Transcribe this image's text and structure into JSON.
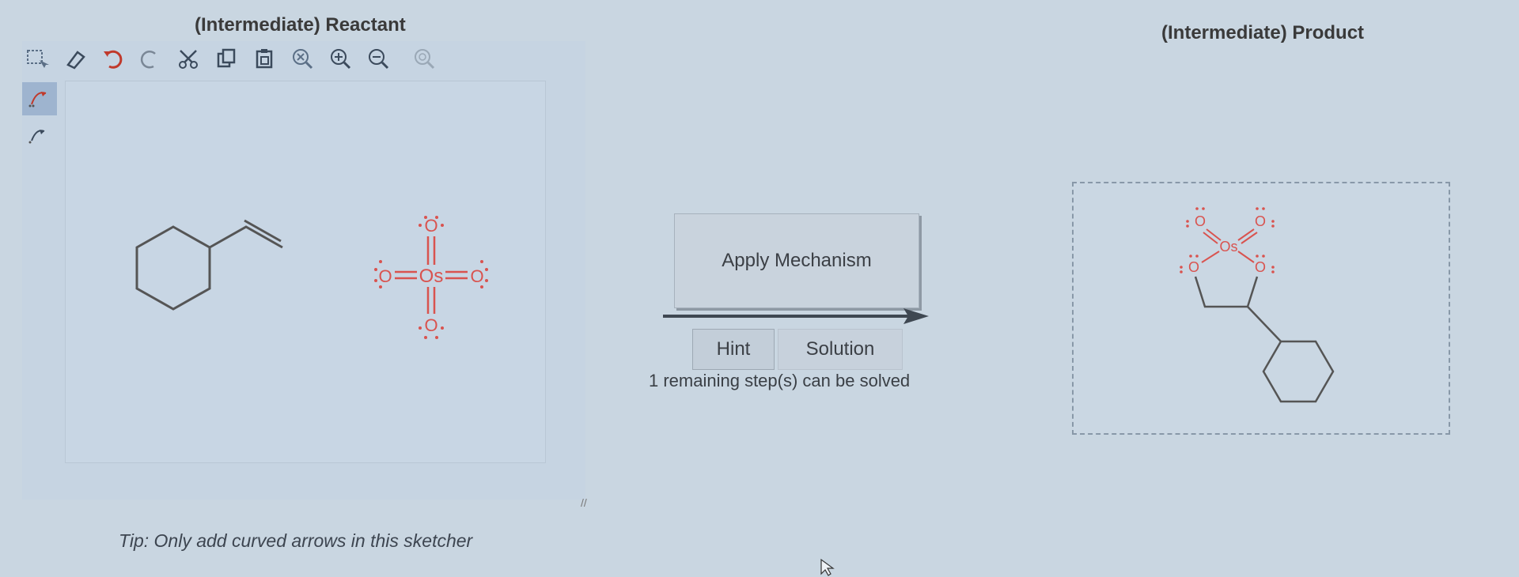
{
  "reactant_panel": {
    "title": "(Intermediate) Reactant",
    "tip": "Tip: Only add curved arrows in this sketcher",
    "toolbar": [
      {
        "name": "select-icon"
      },
      {
        "name": "eraser-icon"
      },
      {
        "name": "undo-icon"
      },
      {
        "name": "redo-icon"
      },
      {
        "name": "cut-icon"
      },
      {
        "name": "copy-icon"
      },
      {
        "name": "paste-icon"
      },
      {
        "name": "zoom-reset-icon"
      },
      {
        "name": "zoom-in-icon"
      },
      {
        "name": "zoom-out-icon"
      },
      {
        "name": "zoom-fit-icon"
      }
    ],
    "side_tools": [
      {
        "name": "curved-arrow-double-icon",
        "active": true
      },
      {
        "name": "curved-arrow-single-icon",
        "active": false
      }
    ],
    "molecules": {
      "osmium_tetroxide": {
        "metal": "Os",
        "oxygen": "O"
      }
    }
  },
  "middle": {
    "apply_label": "Apply Mechanism",
    "hint_label": "Hint",
    "solution_label": "Solution",
    "remaining_text": "1 remaining step(s) can be solved"
  },
  "product_panel": {
    "title": "(Intermediate) Product",
    "molecule": {
      "metal": "Os",
      "oxygen": "O"
    }
  },
  "colors": {
    "background": "#c9d6e1",
    "atom_red": "#d9534f",
    "bond_gray": "#555555",
    "active_tool": "#9eb4cf"
  }
}
